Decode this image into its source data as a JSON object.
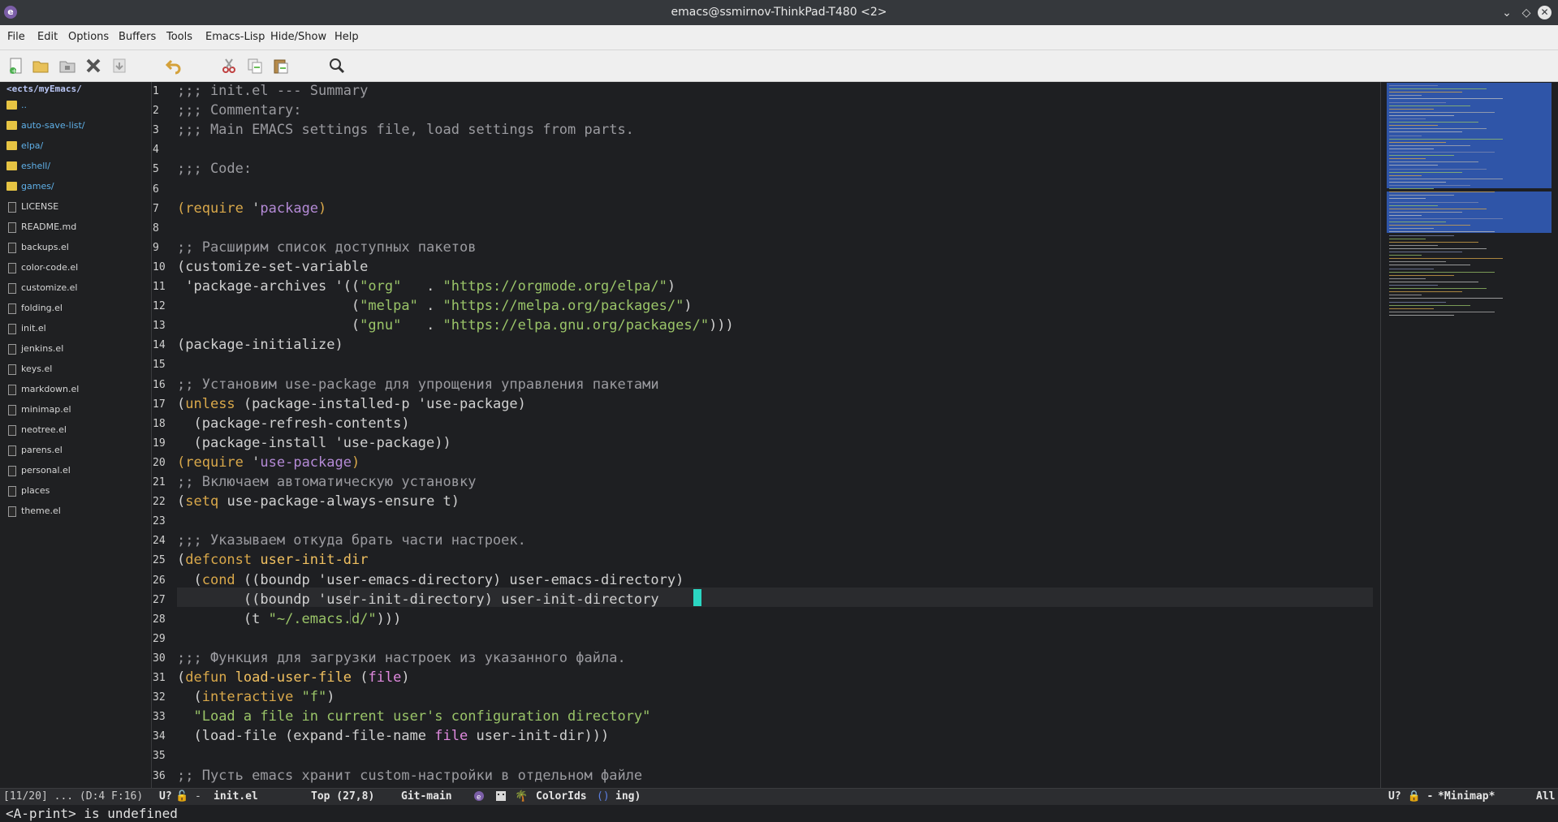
{
  "window": {
    "title": "emacs@ssmirnov-ThinkPad-T480 <2>"
  },
  "menubar": {
    "items": [
      "File",
      "Edit",
      "Options",
      "Buffers",
      "Tools",
      "Emacs-Lisp",
      "Hide/Show",
      "Help"
    ]
  },
  "toolbar": {
    "buttons": [
      "new-file-icon",
      "open-folder-icon",
      "dired-icon",
      "close-icon",
      "save-icon",
      "undo-icon",
      "cut-icon",
      "copy-icon",
      "paste-icon",
      "search-icon"
    ]
  },
  "neotree": {
    "path": "<ects/myEmacs/",
    "entries": [
      {
        "label": "..",
        "type": "dir"
      },
      {
        "label": "auto-save-list/",
        "type": "dir"
      },
      {
        "label": "elpa/",
        "type": "dir"
      },
      {
        "label": "eshell/",
        "type": "dir"
      },
      {
        "label": "games/",
        "type": "dir"
      },
      {
        "label": "LICENSE",
        "type": "file"
      },
      {
        "label": "README.md",
        "type": "file"
      },
      {
        "label": "backups.el",
        "type": "file"
      },
      {
        "label": "color-code.el",
        "type": "file"
      },
      {
        "label": "customize.el",
        "type": "file"
      },
      {
        "label": "folding.el",
        "type": "file"
      },
      {
        "label": "init.el",
        "type": "file"
      },
      {
        "label": "jenkins.el",
        "type": "file"
      },
      {
        "label": "keys.el",
        "type": "file"
      },
      {
        "label": "markdown.el",
        "type": "file"
      },
      {
        "label": "minimap.el",
        "type": "file"
      },
      {
        "label": "neotree.el",
        "type": "file"
      },
      {
        "label": "parens.el",
        "type": "file"
      },
      {
        "label": "personal.el",
        "type": "file"
      },
      {
        "label": "places",
        "type": "file"
      },
      {
        "label": "theme.el",
        "type": "file"
      }
    ]
  },
  "editor": {
    "current_line": 27,
    "lines": [
      {
        "n": "1",
        "segs": [
          [
            ";;; init.el --- Summary",
            "com"
          ]
        ]
      },
      {
        "n": "2",
        "segs": [
          [
            ";;; Commentary:",
            "com"
          ]
        ]
      },
      {
        "n": "3",
        "segs": [
          [
            ";;; Main EMACS settings file, load settings from parts.",
            "com"
          ]
        ]
      },
      {
        "n": "4",
        "segs": []
      },
      {
        "n": "5",
        "segs": [
          [
            ";;; Code:",
            "com"
          ]
        ]
      },
      {
        "n": "6",
        "segs": []
      },
      {
        "n": "7",
        "segs": [
          [
            "(",
            "kw"
          ],
          [
            "require",
            "kw"
          ],
          [
            " '",
            "par"
          ],
          [
            "package",
            "q"
          ],
          [
            ")",
            "kw"
          ]
        ]
      },
      {
        "n": "8",
        "segs": []
      },
      {
        "n": "9",
        "segs": [
          [
            ";; Расширим список доступных пакетов",
            "com"
          ]
        ]
      },
      {
        "n": "10",
        "segs": [
          [
            "(customize-set-variable",
            "par"
          ]
        ]
      },
      {
        "n": "11",
        "segs": [
          [
            " 'package-archives '((",
            "par"
          ],
          [
            "\"org\"",
            "str"
          ],
          [
            "   . ",
            "par"
          ],
          [
            "\"https://orgmode.org/elpa/\"",
            "str"
          ],
          [
            ")",
            "par"
          ]
        ]
      },
      {
        "n": "12",
        "segs": [
          [
            "                     (",
            "par"
          ],
          [
            "\"melpa\"",
            "str"
          ],
          [
            " . ",
            "par"
          ],
          [
            "\"https://melpa.org/packages/\"",
            "str"
          ],
          [
            ")",
            "par"
          ]
        ]
      },
      {
        "n": "13",
        "segs": [
          [
            "                     (",
            "par"
          ],
          [
            "\"gnu\"",
            "str"
          ],
          [
            "   . ",
            "par"
          ],
          [
            "\"https://elpa.gnu.org/packages/\"",
            "str"
          ],
          [
            ")))",
            "par"
          ]
        ]
      },
      {
        "n": "14",
        "segs": [
          [
            "(package-initialize)",
            "par"
          ]
        ]
      },
      {
        "n": "15",
        "segs": []
      },
      {
        "n": "16",
        "segs": [
          [
            ";; Установим use-package для упрощения управления пакетами",
            "com"
          ]
        ]
      },
      {
        "n": "17",
        "segs": [
          [
            "(",
            "par"
          ],
          [
            "unless",
            "kw"
          ],
          [
            " (package-installed-p 'use-package)",
            "par"
          ]
        ]
      },
      {
        "n": "18",
        "segs": [
          [
            "  (package-refresh-contents)",
            "par"
          ]
        ]
      },
      {
        "n": "19",
        "segs": [
          [
            "  (package-install 'use-package))",
            "par"
          ]
        ]
      },
      {
        "n": "20",
        "segs": [
          [
            "(",
            "kw"
          ],
          [
            "require",
            "kw"
          ],
          [
            " '",
            "par"
          ],
          [
            "use-package",
            "q"
          ],
          [
            ")",
            "kw"
          ]
        ]
      },
      {
        "n": "21",
        "segs": [
          [
            ";; Включаем автоматическую установку",
            "com"
          ]
        ]
      },
      {
        "n": "22",
        "segs": [
          [
            "(",
            "par"
          ],
          [
            "setq",
            "kw"
          ],
          [
            " use-package-always-ensure t)",
            "par"
          ]
        ]
      },
      {
        "n": "23",
        "segs": []
      },
      {
        "n": "24",
        "segs": [
          [
            ";;; Указываем откуда брать части настроек.",
            "com"
          ]
        ]
      },
      {
        "n": "25",
        "segs": [
          [
            "(",
            "par"
          ],
          [
            "defconst",
            "kw"
          ],
          [
            " ",
            "par"
          ],
          [
            "user-init-dir",
            "fn"
          ]
        ]
      },
      {
        "n": "26",
        "segs": [
          [
            "  (",
            "par"
          ],
          [
            "cond",
            "kw"
          ],
          [
            " ((boundp 'user-emacs-directory) user-emacs-directory)",
            "par"
          ]
        ]
      },
      {
        "n": "27",
        "segs": [
          [
            "        ((boundp 'user-init-directory) user-init-directory",
            "par"
          ]
        ]
      },
      {
        "n": "28",
        "segs": [
          [
            "        (t ",
            "par"
          ],
          [
            "\"~/.emacs.d/\"",
            "str"
          ],
          [
            ")))",
            "par"
          ]
        ]
      },
      {
        "n": "29",
        "segs": []
      },
      {
        "n": "30",
        "segs": [
          [
            ";;; Функция для загрузки настроек из указанного файла.",
            "com"
          ]
        ]
      },
      {
        "n": "31",
        "segs": [
          [
            "(",
            "par"
          ],
          [
            "defun",
            "kw"
          ],
          [
            " ",
            "par"
          ],
          [
            "load-user-file",
            "fn"
          ],
          [
            " (",
            "par"
          ],
          [
            "file",
            "arg"
          ],
          [
            ")",
            "par"
          ]
        ]
      },
      {
        "n": "32",
        "segs": [
          [
            "  (",
            "par"
          ],
          [
            "interactive",
            "kw"
          ],
          [
            " ",
            "par"
          ],
          [
            "\"f\"",
            "str"
          ],
          [
            ")",
            "par"
          ]
        ]
      },
      {
        "n": "33",
        "segs": [
          [
            "  ",
            "par"
          ],
          [
            "\"Load a file in current user's configuration directory\"",
            "str"
          ]
        ]
      },
      {
        "n": "34",
        "segs": [
          [
            "  (load-file (expand-file-name ",
            "par"
          ],
          [
            "file",
            "arg"
          ],
          [
            " user-init-dir)))",
            "par"
          ]
        ]
      },
      {
        "n": "35",
        "segs": []
      },
      {
        "n": "36",
        "segs": [
          [
            ";; Пусть emacs хранит custom-настройки в отдельном файле",
            "com"
          ]
        ]
      }
    ]
  },
  "modeline": {
    "left_pos": "[11/20] ... (D:4 F:16)",
    "state": "U?",
    "dash": "-",
    "buffer": "init.el",
    "position": "Top (27,8)",
    "vc": "Git-main",
    "modes": "ColorIds",
    "modes_tail": "ing)",
    "right_state": "U? 🔒 -",
    "right_buffer": "*Minimap*",
    "right_pos": "All"
  },
  "echo": {
    "message": "<A-print> is undefined"
  },
  "colors": {
    "accent": "#2f55a8",
    "cursor": "#2bd6c2",
    "keyword": "#d9a84a",
    "string": "#9ac468"
  }
}
